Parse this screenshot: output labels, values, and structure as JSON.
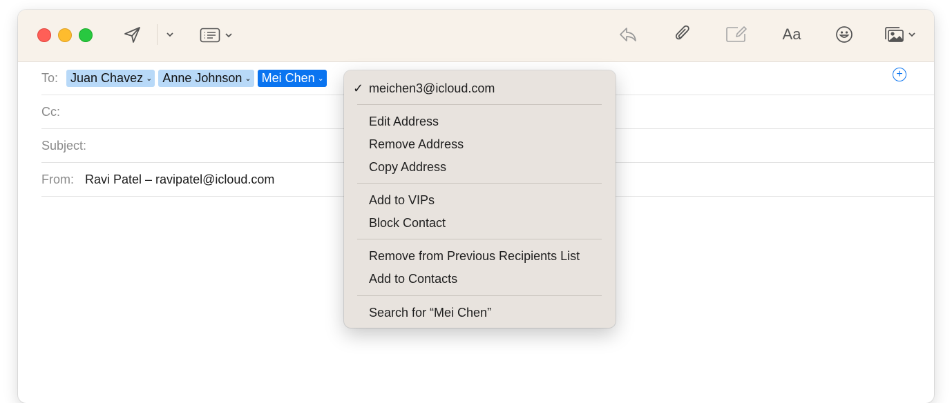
{
  "window": {
    "toolbar": {
      "send_icon": "paper-plane",
      "header_fields_icon": "list-card",
      "reply_icon": "reply-arrow",
      "attach_icon": "paperclip",
      "markup_icon": "markup-pencil",
      "format_label": "Aa",
      "emoji_icon": "smiley",
      "photo_browser_icon": "photos"
    }
  },
  "compose": {
    "to_label": "To:",
    "recipients": [
      "Juan Chavez",
      "Anne Johnson",
      "Mei Chen"
    ],
    "cc_label": "Cc:",
    "subject_label": "Subject:",
    "subject_value": "",
    "from_label": "From:",
    "from_value": "Ravi Patel – ravipatel@icloud.com"
  },
  "context_menu": {
    "email": "meichen3@icloud.com",
    "checkmark": "✓",
    "edit": "Edit Address",
    "remove": "Remove Address",
    "copy": "Copy Address",
    "add_vip": "Add to VIPs",
    "block": "Block Contact",
    "remove_previous": "Remove from Previous Recipients List",
    "add_contacts": "Add to Contacts",
    "search": "Search for “Mei Chen”"
  },
  "colors": {
    "toolbar_bg": "#f8f2ea",
    "chip_bg": "#b8d9f8",
    "chip_selected_bg": "#0a74f0",
    "menu_bg": "#e8e3de",
    "close": "#ff5f57",
    "minimize": "#febc2e",
    "zoom": "#28c840"
  }
}
